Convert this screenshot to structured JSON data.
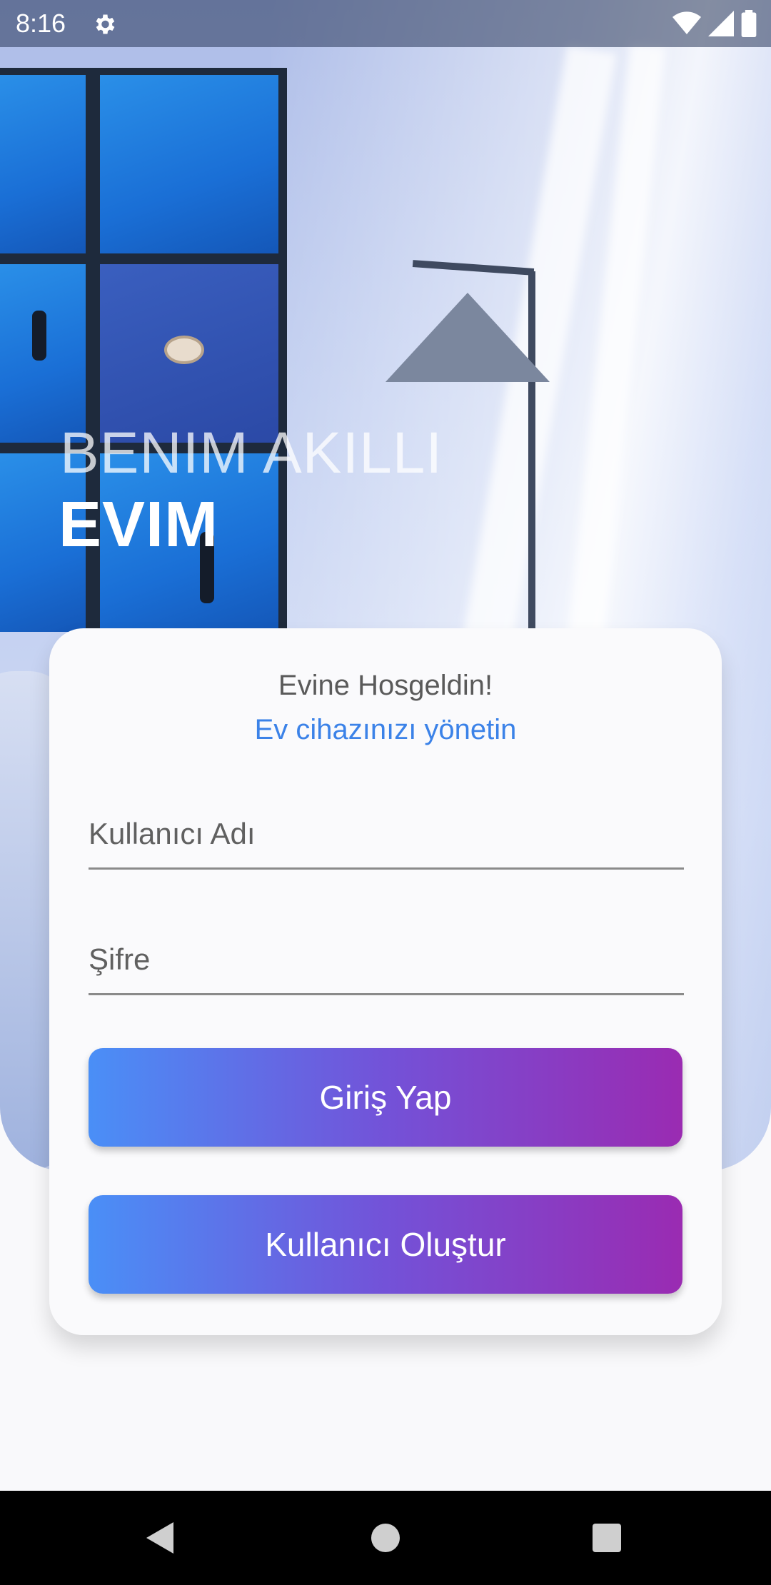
{
  "status_bar": {
    "time": "8:16",
    "icons": [
      "gear-icon",
      "wifi-icon",
      "cell-signal-icon",
      "battery-icon"
    ]
  },
  "hero": {
    "title_line1": "BENIM AKILLI",
    "title_line2": "EVIM"
  },
  "card": {
    "title": "Evine Hosgeldin!",
    "subtitle": "Ev cihazınızı yönetin",
    "username_placeholder": "Kullanıcı Adı",
    "password_placeholder": "Şifre",
    "login_label": "Giriş Yap",
    "register_label": "Kullanıcı Oluştur"
  },
  "nav_bar": {
    "icons": [
      "back-icon",
      "home-icon",
      "recents-icon"
    ]
  },
  "colors": {
    "accent": "#3b82e8",
    "gradient_start": "#4a8ff7",
    "gradient_end": "#9a2bb2",
    "card_background": "#fafafc"
  }
}
